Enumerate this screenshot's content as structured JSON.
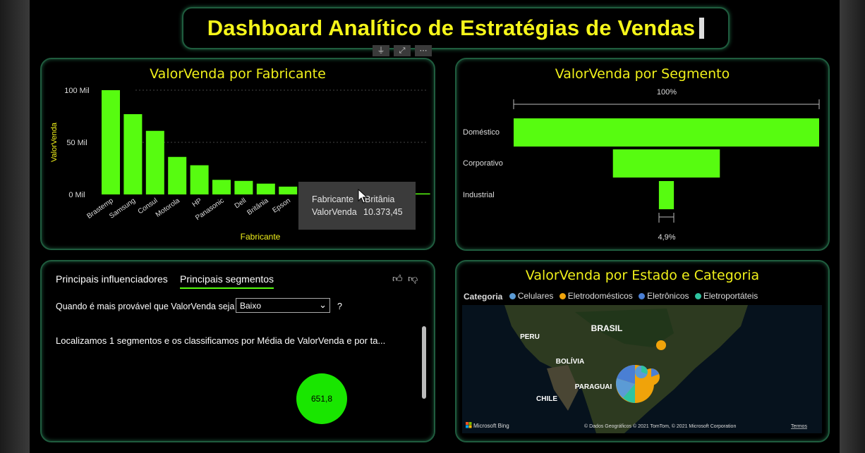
{
  "title": "Dashboard Analítico de Estratégias de Vendas",
  "fabricante_chart": {
    "title": "ValorVenda por Fabricante",
    "xlabel": "Fabricante",
    "ylabel": "ValorVenda",
    "yticks": [
      "100 Mil",
      "50 Mil",
      "0 Mil"
    ],
    "tooltip": {
      "k1": "Fabricante",
      "v1": "Britânia",
      "k2": "ValorVenda",
      "v2": "10.373,45"
    }
  },
  "segmento_chart": {
    "title": "ValorVenda por Segmento",
    "top_label": "100%",
    "bottom_label": "4,9%"
  },
  "influencers": {
    "tab1": "Principais influenciadores",
    "tab2": "Principais segmentos",
    "question": "Quando é mais provável que ValorVenda seja",
    "selected": "Baixo",
    "question_mark": "?",
    "summary": "Localizamos 1 segmentos e os classificamos por Média de ValorVenda e por ta...",
    "bubble_value": "651,8"
  },
  "map_visual": {
    "title": "ValorVenda por Estado e Categoria",
    "legend_title": "Categoria",
    "legend": [
      {
        "name": "Celulares",
        "color": "#5b9bd5"
      },
      {
        "name": "Eletrodomésticos",
        "color": "#f0a30a"
      },
      {
        "name": "Eletrônicos",
        "color": "#4a7fd4"
      },
      {
        "name": "Eletroportáteis",
        "color": "#2ec4a0"
      }
    ],
    "labels": {
      "brasil": "BRASIL",
      "peru": "PERU",
      "bolivia": "BOLÍVIA",
      "paraguai": "PARAGUAI",
      "chile": "CHILE"
    },
    "bing": "Microsoft Bing",
    "credits": "© Dados Geográficos © 2021 TomTom, © 2021 Microsoft Corporation",
    "terms": "Termos"
  },
  "chart_data": [
    {
      "type": "bar",
      "title": "ValorVenda por Fabricante",
      "xlabel": "Fabricante",
      "ylabel": "ValorVenda",
      "categories": [
        "Brastemp",
        "Samsung",
        "Consul",
        "Motorola",
        "HP",
        "Panasonic",
        "Dell",
        "Britânia",
        "Epson",
        "",
        "",
        "",
        "",
        "",
        ""
      ],
      "values": [
        100,
        77,
        61,
        36,
        28,
        14,
        13,
        10.37,
        7.5,
        5,
        4,
        3,
        2,
        1.5,
        1
      ],
      "ylim": [
        0,
        100
      ],
      "color": "#57fc10"
    },
    {
      "type": "bar",
      "title": "ValorVenda por Segmento",
      "categories": [
        "Doméstico",
        "Corporativo",
        "Industrial"
      ],
      "values": [
        100,
        35,
        4.9
      ],
      "color": "#57fc10"
    }
  ]
}
